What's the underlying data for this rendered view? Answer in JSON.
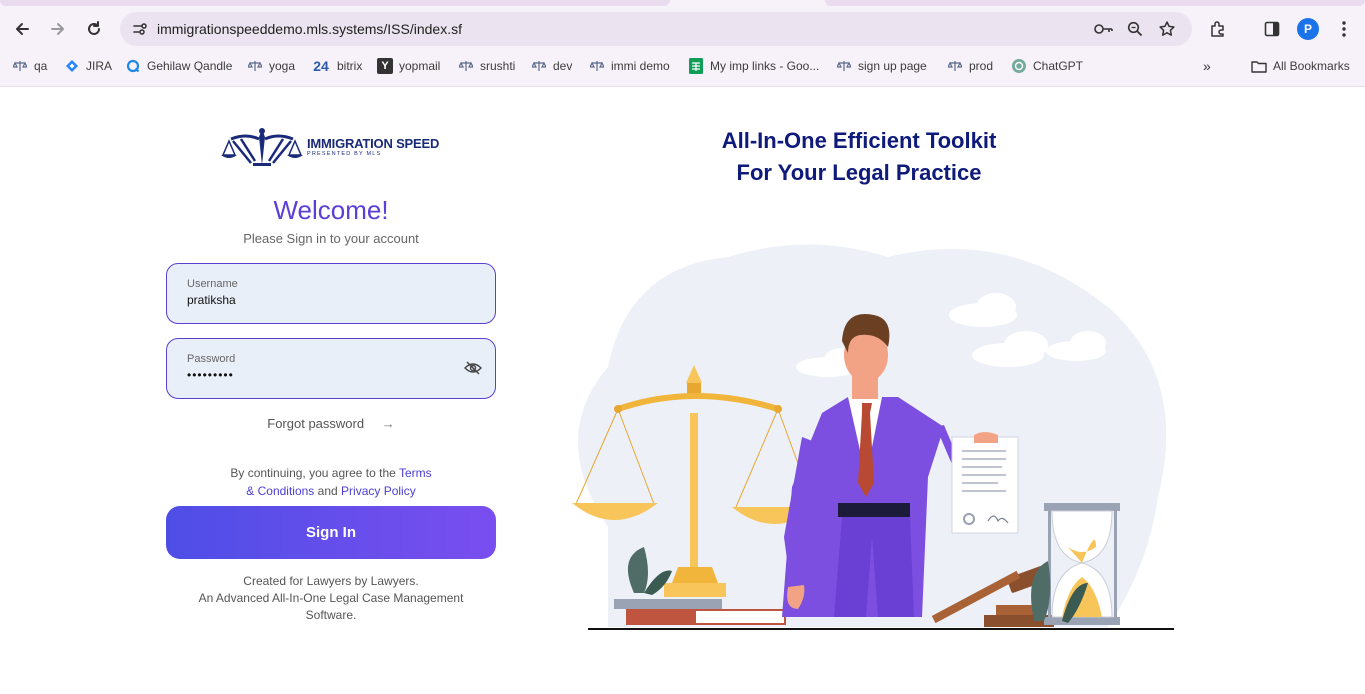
{
  "browser": {
    "url": "immigrationspeeddemo.mls.systems/ISS/index.sf",
    "profile_initial": "P",
    "bookmarks": [
      {
        "label": "qa",
        "icon": "scales-icon"
      },
      {
        "label": "JIRA",
        "icon": "jira-icon"
      },
      {
        "label": "Gehilaw Qandle",
        "icon": "qandle-icon"
      },
      {
        "label": "yoga",
        "icon": "scales-icon"
      },
      {
        "label": "bitrix",
        "icon": "bitrix-icon"
      },
      {
        "label": "yopmail",
        "icon": "yopmail-icon"
      },
      {
        "label": "srushti",
        "icon": "scales-icon"
      },
      {
        "label": "dev",
        "icon": "scales-icon"
      },
      {
        "label": "immi demo",
        "icon": "scales-icon"
      },
      {
        "label": "My imp links - Goo...",
        "icon": "sheets-icon"
      },
      {
        "label": "sign up page",
        "icon": "scales-icon"
      },
      {
        "label": "prod",
        "icon": "scales-icon"
      },
      {
        "label": "ChatGPT",
        "icon": "chatgpt-icon"
      }
    ],
    "all_bookmarks": "All Bookmarks",
    "bitrix_icon_text": "24",
    "yopmail_icon_text": "Y"
  },
  "login": {
    "logo_brand": "IMMIGRATION SPEED",
    "logo_sub": "PRESENTED BY MLS",
    "welcome": "Welcome!",
    "subtitle": "Please Sign in to your account",
    "username_label": "Username",
    "username_value": "pratiksha",
    "password_label": "Password",
    "password_value": "•••••••••",
    "forgot": "Forgot password",
    "forgot_arrow": "→",
    "terms_prefix": "By continuing, you agree to the",
    "terms_link": "Terms",
    "conditions_link": "& Conditions",
    "terms_and": "and",
    "privacy_link": "Privacy Policy",
    "signin": "Sign In",
    "footer_line1": "Created for Lawyers by Lawyers.",
    "footer_line2": "An Advanced All-In-One Legal Case Management",
    "footer_line3": "Software."
  },
  "hero": {
    "headline_line1": "All-In-One Efficient Toolkit",
    "headline_line2": "For Your Legal Practice"
  },
  "colors": {
    "accent": "#5b3fd6",
    "headline": "#0f1b7a",
    "button_start": "#4e4ee6",
    "button_end": "#7a4ef0"
  }
}
